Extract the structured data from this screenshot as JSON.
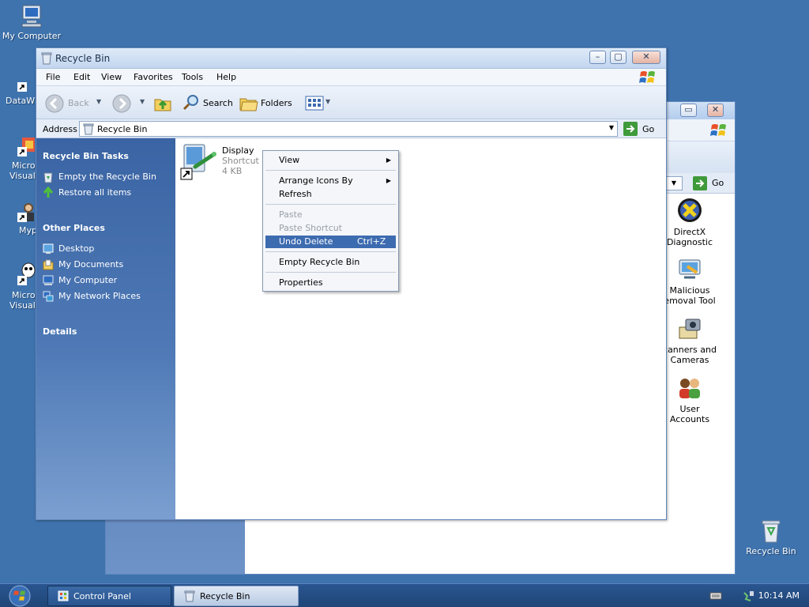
{
  "desktop": {
    "my_computer": "My Computer",
    "partial_datawin": "DataWi",
    "partial_micro1a": "Micro",
    "partial_micro1b": "Visual",
    "partial_myp": "Myp",
    "partial_micro2a": "Micro",
    "partial_micro2b": "Visual",
    "recycle_bin": "Recycle Bin"
  },
  "background_window": {
    "items": [
      {
        "line1": "DirectX",
        "line2": "Diagnostic"
      },
      {
        "line1": "Malicious",
        "line2": "emoval Tool"
      },
      {
        "line1": "canners and",
        "line2": "Cameras"
      },
      {
        "line1": "User",
        "line2": "Accounts"
      }
    ],
    "go_label": "Go"
  },
  "window": {
    "title": "Recycle Bin",
    "menu": [
      "File",
      "Edit",
      "View",
      "Favorites",
      "Tools",
      "Help"
    ],
    "toolbar": {
      "back": "Back",
      "search": "Search",
      "folders": "Folders"
    },
    "address_label": "Address",
    "address_value": "Recycle Bin",
    "go_label": "Go",
    "tasks_heading": "Recycle Bin Tasks",
    "tasks": [
      "Empty the Recycle Bin",
      "Restore all items"
    ],
    "places_heading": "Other Places",
    "places": [
      "Desktop",
      "My Documents",
      "My Computer",
      "My Network Places"
    ],
    "details_heading": "Details",
    "file": {
      "name": "Display",
      "type": "Shortcut",
      "size": "4 KB"
    }
  },
  "context_menu": {
    "view": "View",
    "arrange": "Arrange Icons By",
    "refresh": "Refresh",
    "paste": "Paste",
    "paste_shortcut": "Paste Shortcut",
    "undo_delete": "Undo Delete",
    "undo_shortcut": "Ctrl+Z",
    "empty": "Empty Recycle Bin",
    "properties": "Properties"
  },
  "taskbar": {
    "control_panel": "Control Panel",
    "recycle_bin": "Recycle Bin",
    "clock": "10:14 AM"
  }
}
